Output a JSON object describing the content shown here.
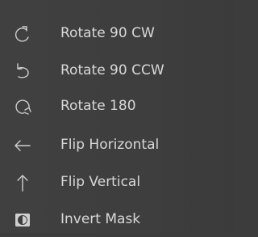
{
  "menu": {
    "items": [
      {
        "label": "Rotate 90 CW",
        "icon": "rotate-cw-icon"
      },
      {
        "label": "Rotate 90 CCW",
        "icon": "rotate-ccw-icon"
      },
      {
        "label": "Rotate 180",
        "icon": "rotate-180-icon"
      },
      {
        "label": "Flip Horizontal",
        "icon": "arrow-left-icon"
      },
      {
        "label": "Flip Vertical",
        "icon": "arrow-up-icon"
      },
      {
        "label": "Invert Mask",
        "icon": "invert-mask-icon"
      }
    ]
  },
  "colors": {
    "background": "#3e3e3e",
    "text": "#d8d8d8",
    "icon": "#cfcfcf"
  }
}
